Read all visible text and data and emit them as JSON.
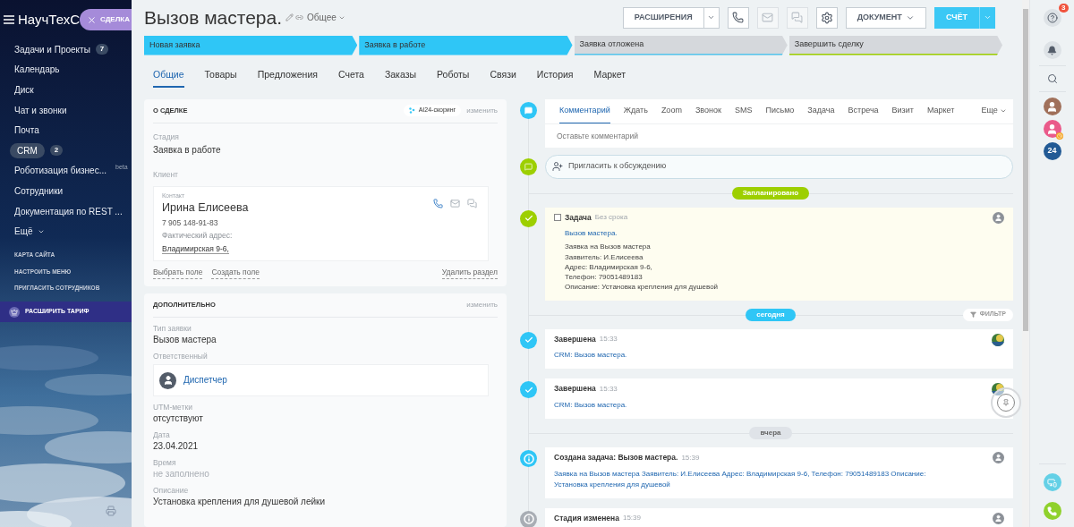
{
  "sidebar": {
    "logo": "НаучТехС",
    "open_tab": "СДЕЛКА",
    "items": [
      {
        "label": "Задачи и Проекты",
        "count": "7",
        "selected": false
      },
      {
        "label": "Календарь",
        "selected": false
      },
      {
        "label": "Диск",
        "selected": false
      },
      {
        "label": "Чат и звонки",
        "selected": false
      },
      {
        "label": "Почта",
        "selected": false
      },
      {
        "label": "CRM",
        "count": "2",
        "selected": true
      },
      {
        "label": "Роботизация бизнес...",
        "note": "beta",
        "selected": false
      },
      {
        "label": "Сотрудники",
        "selected": false
      },
      {
        "label": "Документация по REST ...",
        "selected": false
      },
      {
        "label": "Ещё",
        "selected": false,
        "menu": true
      }
    ],
    "links": [
      "КАРТА САЙТА",
      "НАСТРОИТЬ МЕНЮ",
      "ПРИГЛАСИТЬ СОТРУДНИКОВ"
    ],
    "upgrade": "РАСШИРИТЬ ТАРИФ"
  },
  "header": {
    "title": "Вызов мастера.",
    "category": "Общее",
    "toolbar": [
      {
        "kind": "split",
        "label": "РАСШИРЕНИЯ"
      },
      {
        "kind": "phone",
        "disabled": false
      },
      {
        "kind": "mail",
        "disabled": true
      },
      {
        "kind": "chat",
        "disabled": true
      },
      {
        "kind": "settings",
        "disabled": false
      },
      {
        "kind": "menu",
        "label": "ДОКУМЕНТ"
      },
      {
        "kind": "primary",
        "label": "СЧЁТ"
      }
    ]
  },
  "stages": [
    {
      "label": "Новая заявка",
      "passed": true,
      "color": "#2fc6f6"
    },
    {
      "label": "Заявка в работе",
      "passed": true,
      "color": "#2fc6f6"
    },
    {
      "label": "Заявка отложена",
      "passed": false,
      "color": "#55c5ec"
    },
    {
      "label": "Завершить сделку",
      "passed": false,
      "color": "#9dcf00"
    }
  ],
  "tabs": [
    {
      "label": "Общие",
      "selected": true
    },
    {
      "label": "Товары",
      "selected": false
    },
    {
      "label": "Предложения",
      "selected": false
    },
    {
      "label": "Счета",
      "selected": false
    },
    {
      "label": "Заказы",
      "selected": false
    },
    {
      "label": "Роботы",
      "selected": false
    },
    {
      "label": "Связи",
      "selected": false
    },
    {
      "label": "История",
      "selected": false
    },
    {
      "label": "Маркет",
      "selected": false
    }
  ],
  "deal_card": {
    "title": "О СДЕЛКЕ",
    "badge": "AI24-скоринг",
    "edit": "изменить",
    "stage": {
      "label": "Стадия",
      "value": "Заявка в работе"
    },
    "client_label": "Клиент",
    "contact": {
      "label": "Контакт",
      "name": "Ирина Елисеева",
      "phone": "7 905 148-91-83",
      "address_label": "Фактический адрес:",
      "address": "Владимирская 9-6,"
    },
    "actions": [
      "Выбрать поле",
      "Создать поле"
    ],
    "delete": "Удалить раздел"
  },
  "extra_card": {
    "title": "ДОПОЛНИТЕЛЬНО",
    "edit": "изменить",
    "fields": [
      {
        "kind": "text",
        "label": "Тип заявки",
        "value": "Вызов мастера"
      },
      {
        "kind": "user",
        "label": "Ответственный",
        "value": "Диспетчер"
      },
      {
        "kind": "text",
        "label": "UTM-метки",
        "value": "отсутствуют"
      },
      {
        "kind": "text",
        "label": "Дата",
        "value": "23.04.2021"
      },
      {
        "kind": "empty",
        "label": "Время",
        "value": "не заполнено"
      },
      {
        "kind": "text",
        "label": "Описание",
        "value": "Установка крепления для душевой лейки"
      }
    ]
  },
  "composer": {
    "tabs": [
      {
        "label": "Комментарий",
        "selected": true
      },
      {
        "label": "Ждать",
        "selected": false
      },
      {
        "label": "Zoom",
        "selected": false
      },
      {
        "label": "Звонок",
        "selected": false
      },
      {
        "label": "SMS",
        "selected": false
      },
      {
        "label": "Письмо",
        "selected": false
      },
      {
        "label": "Задача",
        "selected": false
      },
      {
        "label": "Встреча",
        "selected": false
      },
      {
        "label": "Визит",
        "selected": false
      },
      {
        "label": "Маркет",
        "selected": false
      }
    ],
    "more": "Еще",
    "placeholder": "Оставьте комментарий",
    "invite": "Пригласить к обсуждению"
  },
  "timeline": [
    {
      "kind": "separator",
      "label": "Запланировано",
      "color": "#9dcf00"
    },
    {
      "kind": "task",
      "color": "#9dcf00",
      "checked": false,
      "title": "Задача",
      "meta": "Без срока",
      "link": "Вызов мастера.",
      "lines": [
        "Заявка на Вызов мастера",
        "Заявитель: И.Елисеева",
        "Адрес: Владимирская 9-6,",
        "Телефон: 79051489183",
        "Описание: Установка крепления для душевой"
      ],
      "avatar": {
        "kind": "user"
      }
    },
    {
      "kind": "separator",
      "label": "сегодня",
      "color": "#2fc6f6",
      "filter": "ФИЛЬТР"
    },
    {
      "kind": "done",
      "color": "#2fc6f6",
      "title": "Завершена",
      "time": "15:33",
      "link": "CRM: Вызов мастера."
    },
    {
      "kind": "done",
      "color": "#2fc6f6",
      "title": "Завершена",
      "time": "15:33",
      "link": "CRM: Вызов мастера.",
      "pin": true
    },
    {
      "kind": "separator",
      "label": "вчера",
      "color": "#dfe3e8"
    },
    {
      "kind": "info",
      "color": "#2fc6f6",
      "title": "Создана задача: Вызов мастера.",
      "time": "15:39",
      "link": "Заявка на Вызов мастера Заявитель: И.Елисеева Адрес: Владимирская 9-6, Телефон: 79051489183 Описание: Установка крепления для душевой",
      "avatar": {
        "kind": "user"
      }
    },
    {
      "kind": "info",
      "color": "#a8adb4",
      "title": "Стадия изменена",
      "time": "15:39",
      "avatar": {
        "kind": "user"
      }
    }
  ],
  "right_bar": {
    "help_badge": "3",
    "app_label": "24"
  }
}
